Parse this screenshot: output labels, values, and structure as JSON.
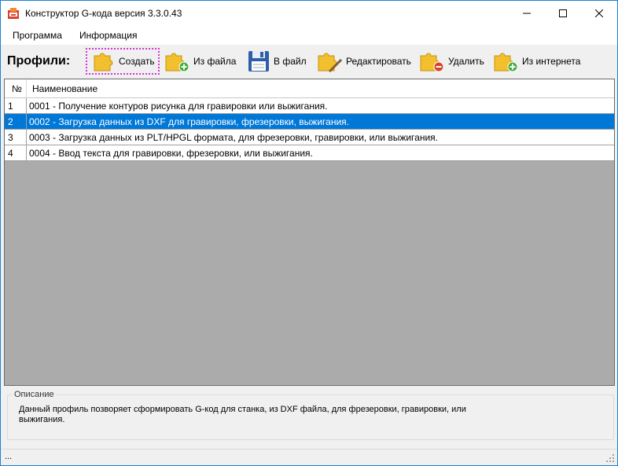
{
  "window": {
    "title": "Конструктор G-кода версия 3.3.0.43",
    "buttons": {
      "minimize": "minimize-icon",
      "maximize": "maximize-icon",
      "close": "close-icon"
    }
  },
  "menu": {
    "items": [
      "Программа",
      "Информация"
    ]
  },
  "toolbar": {
    "label": "Профили:",
    "buttons": [
      {
        "label": "Создать",
        "icon": "puzzle-icon"
      },
      {
        "label": "Из файла",
        "icon": "puzzle-add-icon"
      },
      {
        "label": "В файл",
        "icon": "floppy-disk-icon"
      },
      {
        "label": "Редактировать",
        "icon": "puzzle-edit-icon"
      },
      {
        "label": "Удалить",
        "icon": "puzzle-remove-icon"
      },
      {
        "label": "Из интернета",
        "icon": "puzzle-add-icon"
      }
    ],
    "selected_index": 0
  },
  "grid": {
    "columns": [
      "№",
      "Наименование"
    ],
    "rows": [
      {
        "num": "1",
        "name": "0001 - Получение контуров рисунка для гравировки или выжигания."
      },
      {
        "num": "2",
        "name": "0002 - Загрузка данных из DXF для гравировки, фрезеровки, выжигания."
      },
      {
        "num": "3",
        "name": "0003 - Загрузка данных из PLT/HPGL формата, для фрезеровки, гравировки, или выжигания."
      },
      {
        "num": "4",
        "name": "0004 - Ввод текста для гравировки, фрезеровки, или выжигания."
      }
    ],
    "selected_row": 1
  },
  "description": {
    "legend": "Описание",
    "text": "Данный профиль позворяет сформировать G-код для станка, из DXF файла, для фрезеровки, гравировки, или выжигания."
  },
  "status": {
    "text": "..."
  },
  "colors": {
    "accent": "#0078d7",
    "window_border": "#1883d7",
    "focus_dots": "#d633d6",
    "puzzle": "#f2c02e",
    "grid_empty": "#ababab"
  }
}
